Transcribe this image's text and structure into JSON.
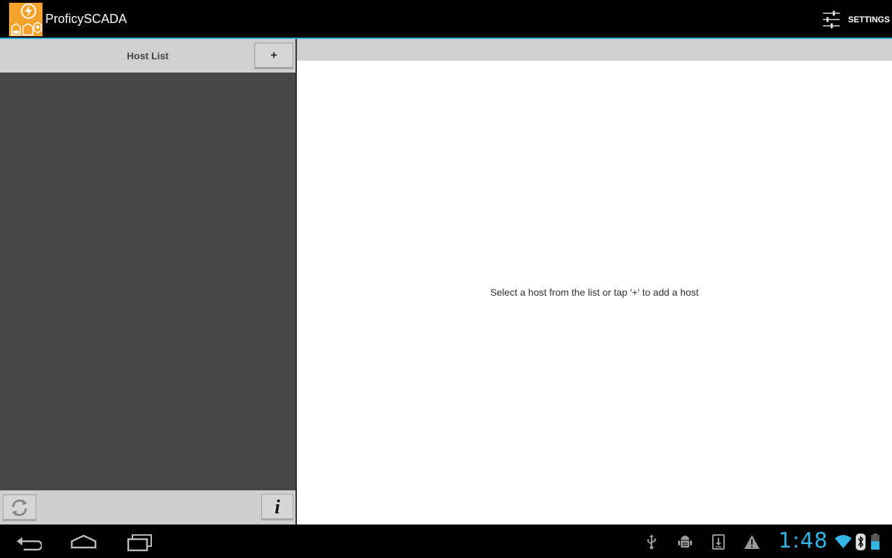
{
  "app": {
    "title": "ProficySCADA",
    "logo_icon": "proficy-scada-logo-icon"
  },
  "action_bar": {
    "settings_label": "SETTINGS",
    "settings_icon": "sliders-icon",
    "accent_color": "#33b5e5"
  },
  "host_list": {
    "title": "Host List",
    "add_label": "+",
    "refresh_icon": "refresh-icon",
    "info_label": "i"
  },
  "detail": {
    "empty_message": "Select a host from the list or tap '+' to add a host"
  },
  "system_bar": {
    "time": "1:48",
    "nav_icons": [
      "back-icon",
      "home-icon",
      "recent-apps-icon"
    ],
    "status_icons": [
      "usb-icon",
      "android-debug-icon",
      "download-icon",
      "warning-icon",
      "wifi-icon",
      "bluetooth-icon",
      "battery-icon"
    ],
    "clock_color": "#33b5e5"
  }
}
